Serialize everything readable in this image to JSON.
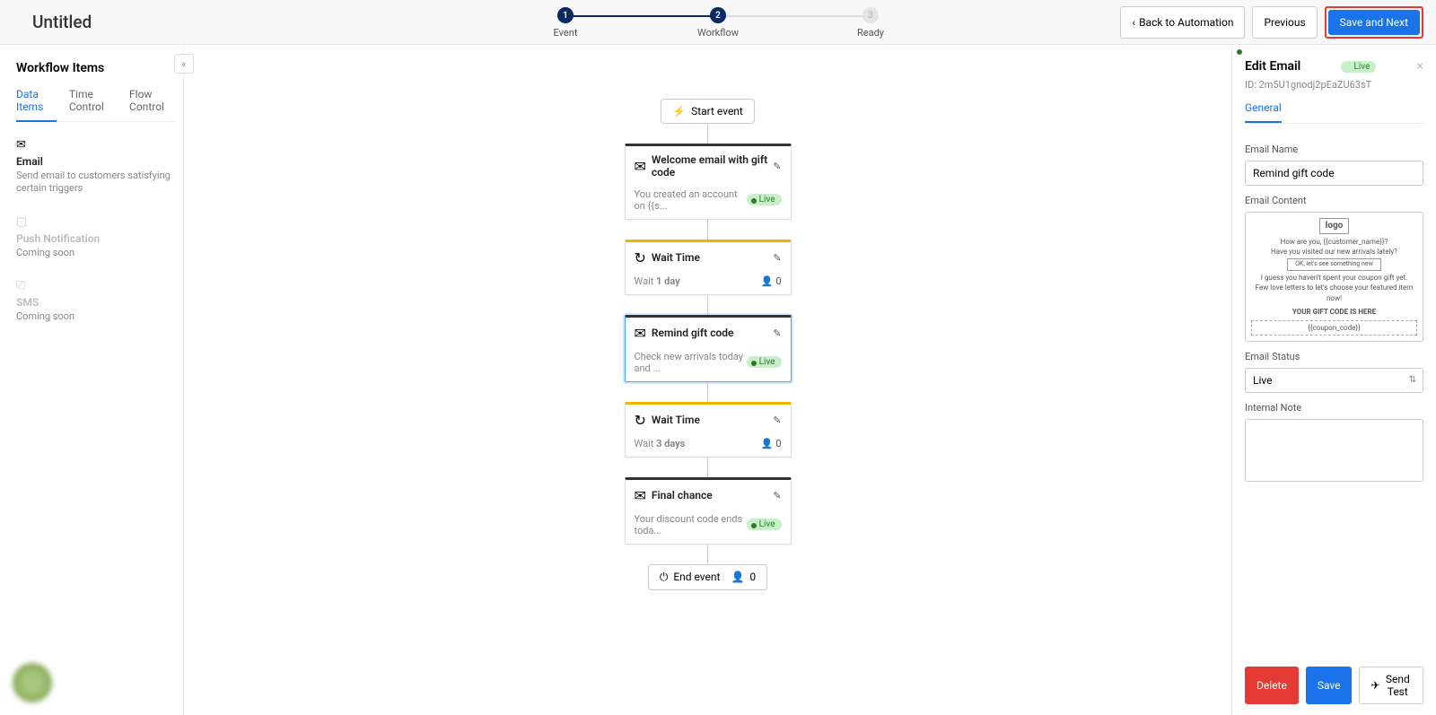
{
  "header": {
    "title": "Untitled",
    "back": "Back to Automation",
    "previous": "Previous",
    "saveNext": "Save and Next",
    "steps": [
      {
        "num": "1",
        "label": "Event",
        "active": true
      },
      {
        "num": "2",
        "label": "Workflow",
        "active": true
      },
      {
        "num": "3",
        "label": "Ready",
        "active": false
      }
    ]
  },
  "sidebar": {
    "title": "Workflow Items",
    "tabs": [
      "Data Items",
      "Time Control",
      "Flow Control"
    ],
    "items": [
      {
        "icon": "email-icon",
        "title": "Email",
        "desc": "Send email to customers satisfying certain triggers"
      },
      {
        "icon": "bell-icon",
        "title": "Push Notification",
        "desc": "Coming soon"
      },
      {
        "icon": "sms-icon",
        "title": "SMS",
        "desc": "Coming soon"
      }
    ]
  },
  "flow": {
    "start": "Start event",
    "end": "End event",
    "endCount": "0",
    "nodes": [
      {
        "type": "email",
        "title": "Welcome email with gift code",
        "sub": "You created an account on {{s...",
        "live": "Live"
      },
      {
        "type": "wait",
        "title": "Wait Time",
        "sub_prefix": "Wait ",
        "sub_bold": "1 day",
        "count": "0"
      },
      {
        "type": "email",
        "title": "Remind gift code",
        "sub": "Check new arrivals today and ...",
        "live": "Live",
        "selected": true
      },
      {
        "type": "wait",
        "title": "Wait Time",
        "sub_prefix": "Wait ",
        "sub_bold": "3 days",
        "count": "0"
      },
      {
        "type": "email",
        "title": "Final chance",
        "sub": "Your discount code ends toda...",
        "live": "Live"
      }
    ]
  },
  "right": {
    "title": "Edit Email",
    "badge": "Live",
    "id": "ID: 2m5U1gnodj2pEaZU63sT",
    "tab": "General",
    "labels": {
      "name": "Email Name",
      "content": "Email Content",
      "status": "Email Status",
      "note": "Internal Note"
    },
    "nameValue": "Remind gift code",
    "statusValue": "Live",
    "preview": {
      "logo": "logo",
      "line1": "How are you, {{customer_name}}?",
      "line2": "Have you visited our new arrivals lately?",
      "btn": "OK, let's see something new",
      "line3": "I guess you haven't spent your coupon gift yet.",
      "line4": "Few love letters to let's choose your featured item now!",
      "codeLabel": "YOUR GIFT CODE IS HERE",
      "code": "{{coupon_code}}"
    },
    "footer": {
      "delete": "Delete",
      "save": "Save",
      "sendTest": "Send Test"
    }
  }
}
